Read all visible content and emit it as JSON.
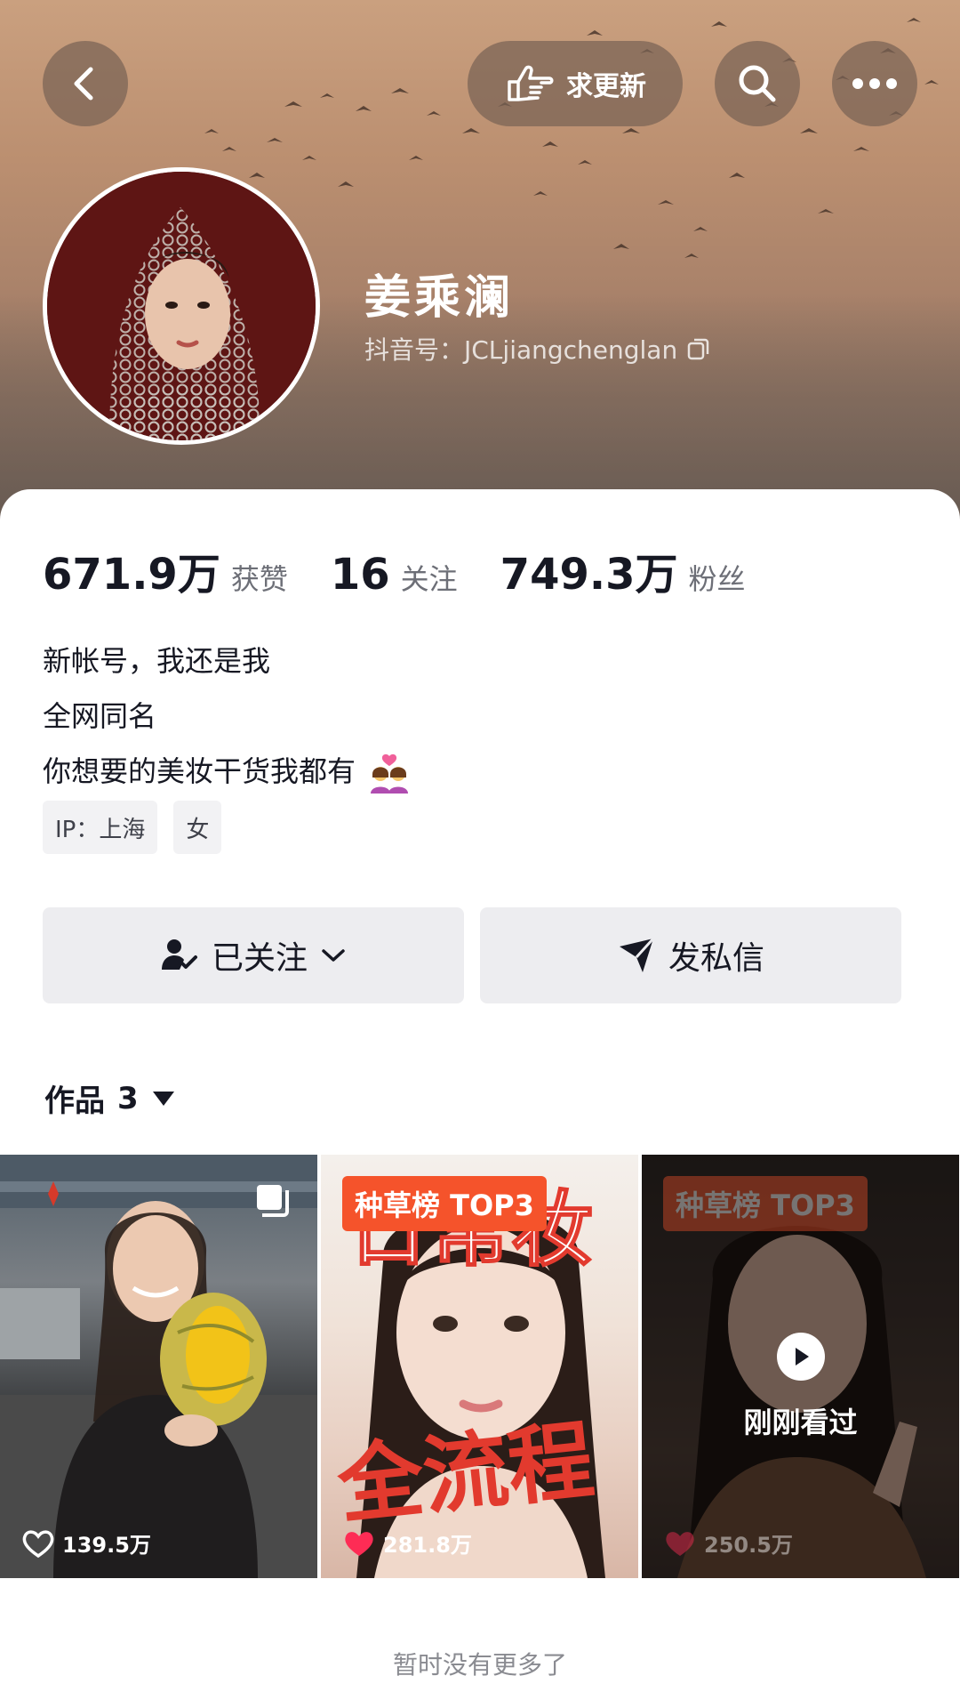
{
  "header": {
    "update_label": "求更新",
    "name": "姜乘澜",
    "douyin_id": "抖音号：JCLjiangchenglan"
  },
  "stats": [
    {
      "value": "671.9万",
      "label": "获赞"
    },
    {
      "value": "16",
      "label": "关注"
    },
    {
      "value": "749.3万",
      "label": "粉丝"
    }
  ],
  "bio": {
    "line1": "新帐号，我还是我",
    "line2": "全网同名",
    "line3": "你想要的美妆干货我都有"
  },
  "tags": {
    "ip": "IP：上海",
    "gender": "女"
  },
  "actions": {
    "followed_label": "已关注",
    "message_label": "发私信"
  },
  "works": {
    "label": "作品",
    "count": "3"
  },
  "videos": [
    {
      "likes": "139.5万"
    },
    {
      "badge": "种草榜 TOP3",
      "overlay_top": "日常妆",
      "overlay_bottom": "全流程",
      "likes": "281.8万"
    },
    {
      "badge": "种草榜 TOP3",
      "status": "刚刚看过",
      "likes": "250.5万"
    }
  ],
  "footer": {
    "no_more": "暂时没有更多了"
  },
  "colors": {
    "accent_badge": "#f5532b",
    "like_heart": "#fe2c55",
    "button_bg": "#ededf0"
  }
}
